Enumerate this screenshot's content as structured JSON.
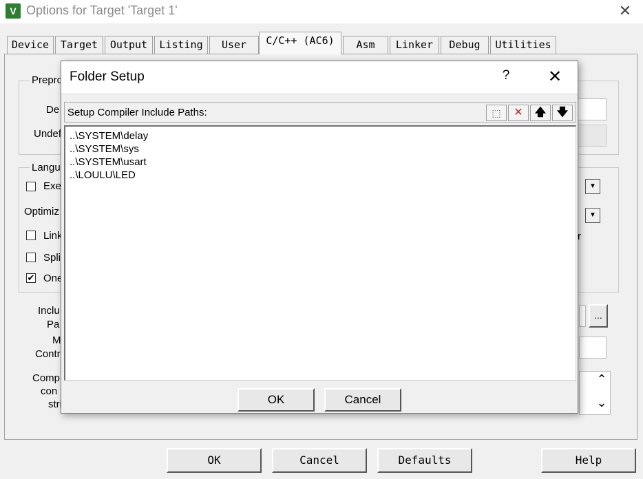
{
  "window": {
    "title": "Options for Target 'Target 1'",
    "icon": "keil-uvision-icon"
  },
  "tabs": [
    {
      "label": "Device"
    },
    {
      "label": "Target"
    },
    {
      "label": "Output"
    },
    {
      "label": "Listing"
    },
    {
      "label": "User"
    },
    {
      "label": "C/C++ (AC6)",
      "active": true
    },
    {
      "label": "Asm"
    },
    {
      "label": "Linker"
    },
    {
      "label": "Debug"
    },
    {
      "label": "Utilities"
    }
  ],
  "background_panel": {
    "preprocessor_group_label": "Prepro",
    "define_label": "De",
    "undefine_label": "Undef",
    "language_group_label": "Langu",
    "execute_only_label": "Exe",
    "optimization_label": "Optimiz",
    "link_label": "Link",
    "split_label": "Spli",
    "one_label": "One",
    "one_checked_mark": "✔",
    "include_paths_label_1": "Inclu",
    "include_paths_label_2": "Pa",
    "misc_label_1": "M",
    "misc_label_2": "Contr",
    "compiler_label_1": "Comp",
    "compiler_label_2": "con",
    "compiler_label_3": "stri",
    "right_letter": "r",
    "browse_button": "...",
    "scroll_up": "⌃",
    "scroll_down": "⌄"
  },
  "dialog": {
    "title": "Folder Setup",
    "help": "?",
    "header_label": "Setup Compiler Include Paths:",
    "toolbar": {
      "new_folder": "⬚",
      "delete": "✕",
      "move_up": "🡅",
      "move_down": "🡇"
    },
    "paths": [
      "..\\SYSTEM\\delay",
      "..\\SYSTEM\\sys",
      "..\\SYSTEM\\usart",
      "..\\LOULU\\LED"
    ],
    "ok_label": "OK",
    "cancel_label": "Cancel"
  },
  "footer": {
    "ok": "OK",
    "cancel": "Cancel",
    "defaults": "Defaults",
    "help": "Help"
  },
  "colors": {
    "delete_icon": "#c62828",
    "window_bg": "#f0f0f0",
    "title_text": "#8a8a8a"
  }
}
